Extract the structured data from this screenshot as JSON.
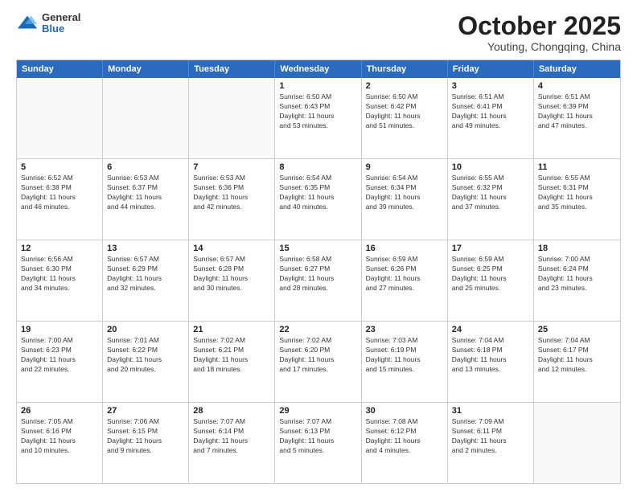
{
  "header": {
    "logo": {
      "general": "General",
      "blue": "Blue"
    },
    "title": "October 2025",
    "location": "Youting, Chongqing, China"
  },
  "calendar": {
    "days_of_week": [
      "Sunday",
      "Monday",
      "Tuesday",
      "Wednesday",
      "Thursday",
      "Friday",
      "Saturday"
    ],
    "rows": [
      [
        {
          "day": "",
          "info": ""
        },
        {
          "day": "",
          "info": ""
        },
        {
          "day": "",
          "info": ""
        },
        {
          "day": "1",
          "info": "Sunrise: 6:50 AM\nSunset: 6:43 PM\nDaylight: 11 hours\nand 53 minutes."
        },
        {
          "day": "2",
          "info": "Sunrise: 6:50 AM\nSunset: 6:42 PM\nDaylight: 11 hours\nand 51 minutes."
        },
        {
          "day": "3",
          "info": "Sunrise: 6:51 AM\nSunset: 6:41 PM\nDaylight: 11 hours\nand 49 minutes."
        },
        {
          "day": "4",
          "info": "Sunrise: 6:51 AM\nSunset: 6:39 PM\nDaylight: 11 hours\nand 47 minutes."
        }
      ],
      [
        {
          "day": "5",
          "info": "Sunrise: 6:52 AM\nSunset: 6:38 PM\nDaylight: 11 hours\nand 46 minutes."
        },
        {
          "day": "6",
          "info": "Sunrise: 6:53 AM\nSunset: 6:37 PM\nDaylight: 11 hours\nand 44 minutes."
        },
        {
          "day": "7",
          "info": "Sunrise: 6:53 AM\nSunset: 6:36 PM\nDaylight: 11 hours\nand 42 minutes."
        },
        {
          "day": "8",
          "info": "Sunrise: 6:54 AM\nSunset: 6:35 PM\nDaylight: 11 hours\nand 40 minutes."
        },
        {
          "day": "9",
          "info": "Sunrise: 6:54 AM\nSunset: 6:34 PM\nDaylight: 11 hours\nand 39 minutes."
        },
        {
          "day": "10",
          "info": "Sunrise: 6:55 AM\nSunset: 6:32 PM\nDaylight: 11 hours\nand 37 minutes."
        },
        {
          "day": "11",
          "info": "Sunrise: 6:55 AM\nSunset: 6:31 PM\nDaylight: 11 hours\nand 35 minutes."
        }
      ],
      [
        {
          "day": "12",
          "info": "Sunrise: 6:56 AM\nSunset: 6:30 PM\nDaylight: 11 hours\nand 34 minutes."
        },
        {
          "day": "13",
          "info": "Sunrise: 6:57 AM\nSunset: 6:29 PM\nDaylight: 11 hours\nand 32 minutes."
        },
        {
          "day": "14",
          "info": "Sunrise: 6:57 AM\nSunset: 6:28 PM\nDaylight: 11 hours\nand 30 minutes."
        },
        {
          "day": "15",
          "info": "Sunrise: 6:58 AM\nSunset: 6:27 PM\nDaylight: 11 hours\nand 28 minutes."
        },
        {
          "day": "16",
          "info": "Sunrise: 6:59 AM\nSunset: 6:26 PM\nDaylight: 11 hours\nand 27 minutes."
        },
        {
          "day": "17",
          "info": "Sunrise: 6:59 AM\nSunset: 6:25 PM\nDaylight: 11 hours\nand 25 minutes."
        },
        {
          "day": "18",
          "info": "Sunrise: 7:00 AM\nSunset: 6:24 PM\nDaylight: 11 hours\nand 23 minutes."
        }
      ],
      [
        {
          "day": "19",
          "info": "Sunrise: 7:00 AM\nSunset: 6:23 PM\nDaylight: 11 hours\nand 22 minutes."
        },
        {
          "day": "20",
          "info": "Sunrise: 7:01 AM\nSunset: 6:22 PM\nDaylight: 11 hours\nand 20 minutes."
        },
        {
          "day": "21",
          "info": "Sunrise: 7:02 AM\nSunset: 6:21 PM\nDaylight: 11 hours\nand 18 minutes."
        },
        {
          "day": "22",
          "info": "Sunrise: 7:02 AM\nSunset: 6:20 PM\nDaylight: 11 hours\nand 17 minutes."
        },
        {
          "day": "23",
          "info": "Sunrise: 7:03 AM\nSunset: 6:19 PM\nDaylight: 11 hours\nand 15 minutes."
        },
        {
          "day": "24",
          "info": "Sunrise: 7:04 AM\nSunset: 6:18 PM\nDaylight: 11 hours\nand 13 minutes."
        },
        {
          "day": "25",
          "info": "Sunrise: 7:04 AM\nSunset: 6:17 PM\nDaylight: 11 hours\nand 12 minutes."
        }
      ],
      [
        {
          "day": "26",
          "info": "Sunrise: 7:05 AM\nSunset: 6:16 PM\nDaylight: 11 hours\nand 10 minutes."
        },
        {
          "day": "27",
          "info": "Sunrise: 7:06 AM\nSunset: 6:15 PM\nDaylight: 11 hours\nand 9 minutes."
        },
        {
          "day": "28",
          "info": "Sunrise: 7:07 AM\nSunset: 6:14 PM\nDaylight: 11 hours\nand 7 minutes."
        },
        {
          "day": "29",
          "info": "Sunrise: 7:07 AM\nSunset: 6:13 PM\nDaylight: 11 hours\nand 5 minutes."
        },
        {
          "day": "30",
          "info": "Sunrise: 7:08 AM\nSunset: 6:12 PM\nDaylight: 11 hours\nand 4 minutes."
        },
        {
          "day": "31",
          "info": "Sunrise: 7:09 AM\nSunset: 6:11 PM\nDaylight: 11 hours\nand 2 minutes."
        },
        {
          "day": "",
          "info": ""
        }
      ]
    ]
  }
}
